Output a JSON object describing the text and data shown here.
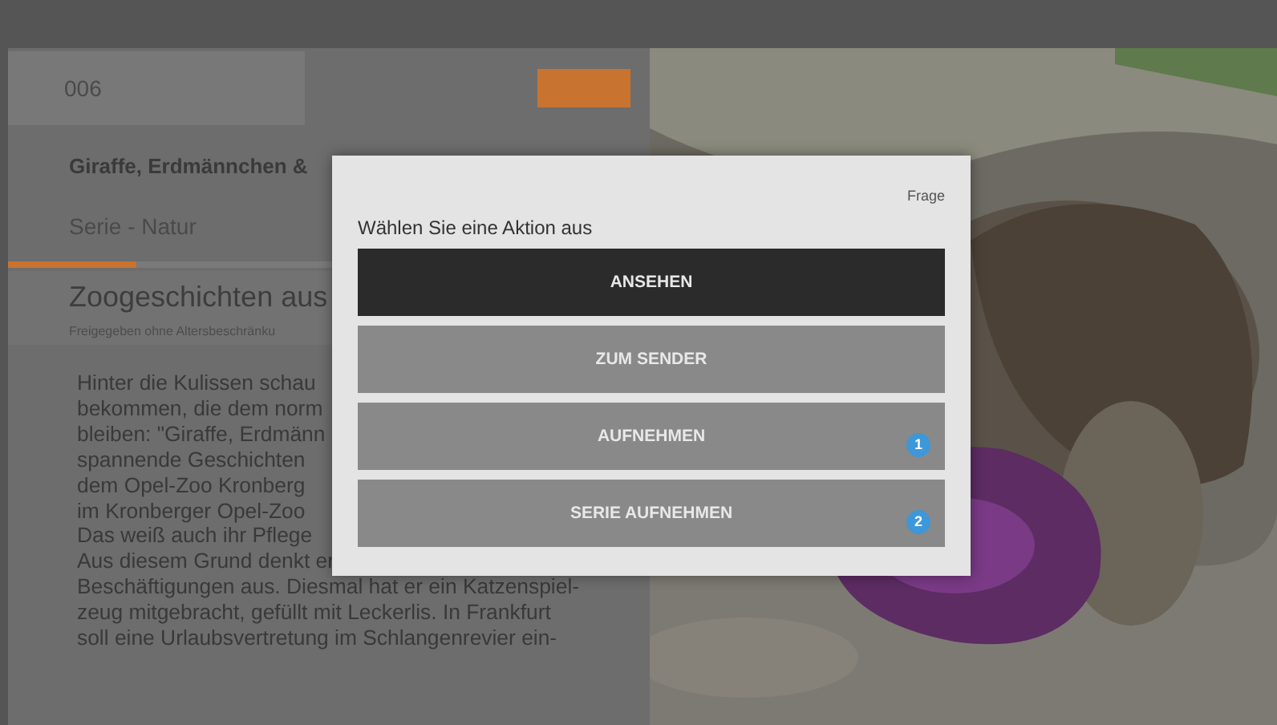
{
  "detail": {
    "channel_field": {
      "value": "006"
    },
    "title": "Giraffe, Erdmännchen &",
    "genre": "Serie - Natur",
    "progress": {
      "level": 0.2
    },
    "episode_title": "Zoogeschichten aus",
    "rating": "Freigegeben ohne Altersbeschränku",
    "description_lines": [
      "Hinter die Kulissen schau",
      "bekommen, die dem norm",
      "bleiben: \"Giraffe, Erdmänn",
      "spannende Geschichten",
      "dem Opel-Zoo Kronberg",
      "im Kronberger Opel-Zoo",
      "Das weiß auch ihr Pflege",
      "Aus diesem Grund denkt er",
      "Beschäftigungen aus. Diesmal hat er ein Katzenspiel-",
      "zeug mitgebracht, gefüllt mit Leckerlis. In Frankfurt",
      "soll eine Urlaubsvertretung im Schlangenrevier ein-"
    ]
  },
  "dialog": {
    "title": "Frage",
    "prompt": "Wählen Sie eine Aktion aus",
    "actions": [
      {
        "label": "ANSEHEN",
        "selected": true
      },
      {
        "label": "ZUM SENDER",
        "selected": false
      },
      {
        "label": "AUFNEHMEN",
        "selected": false,
        "badge": "1"
      },
      {
        "label": "SERIE AUFNEHMEN",
        "selected": false,
        "badge": "2"
      }
    ]
  }
}
